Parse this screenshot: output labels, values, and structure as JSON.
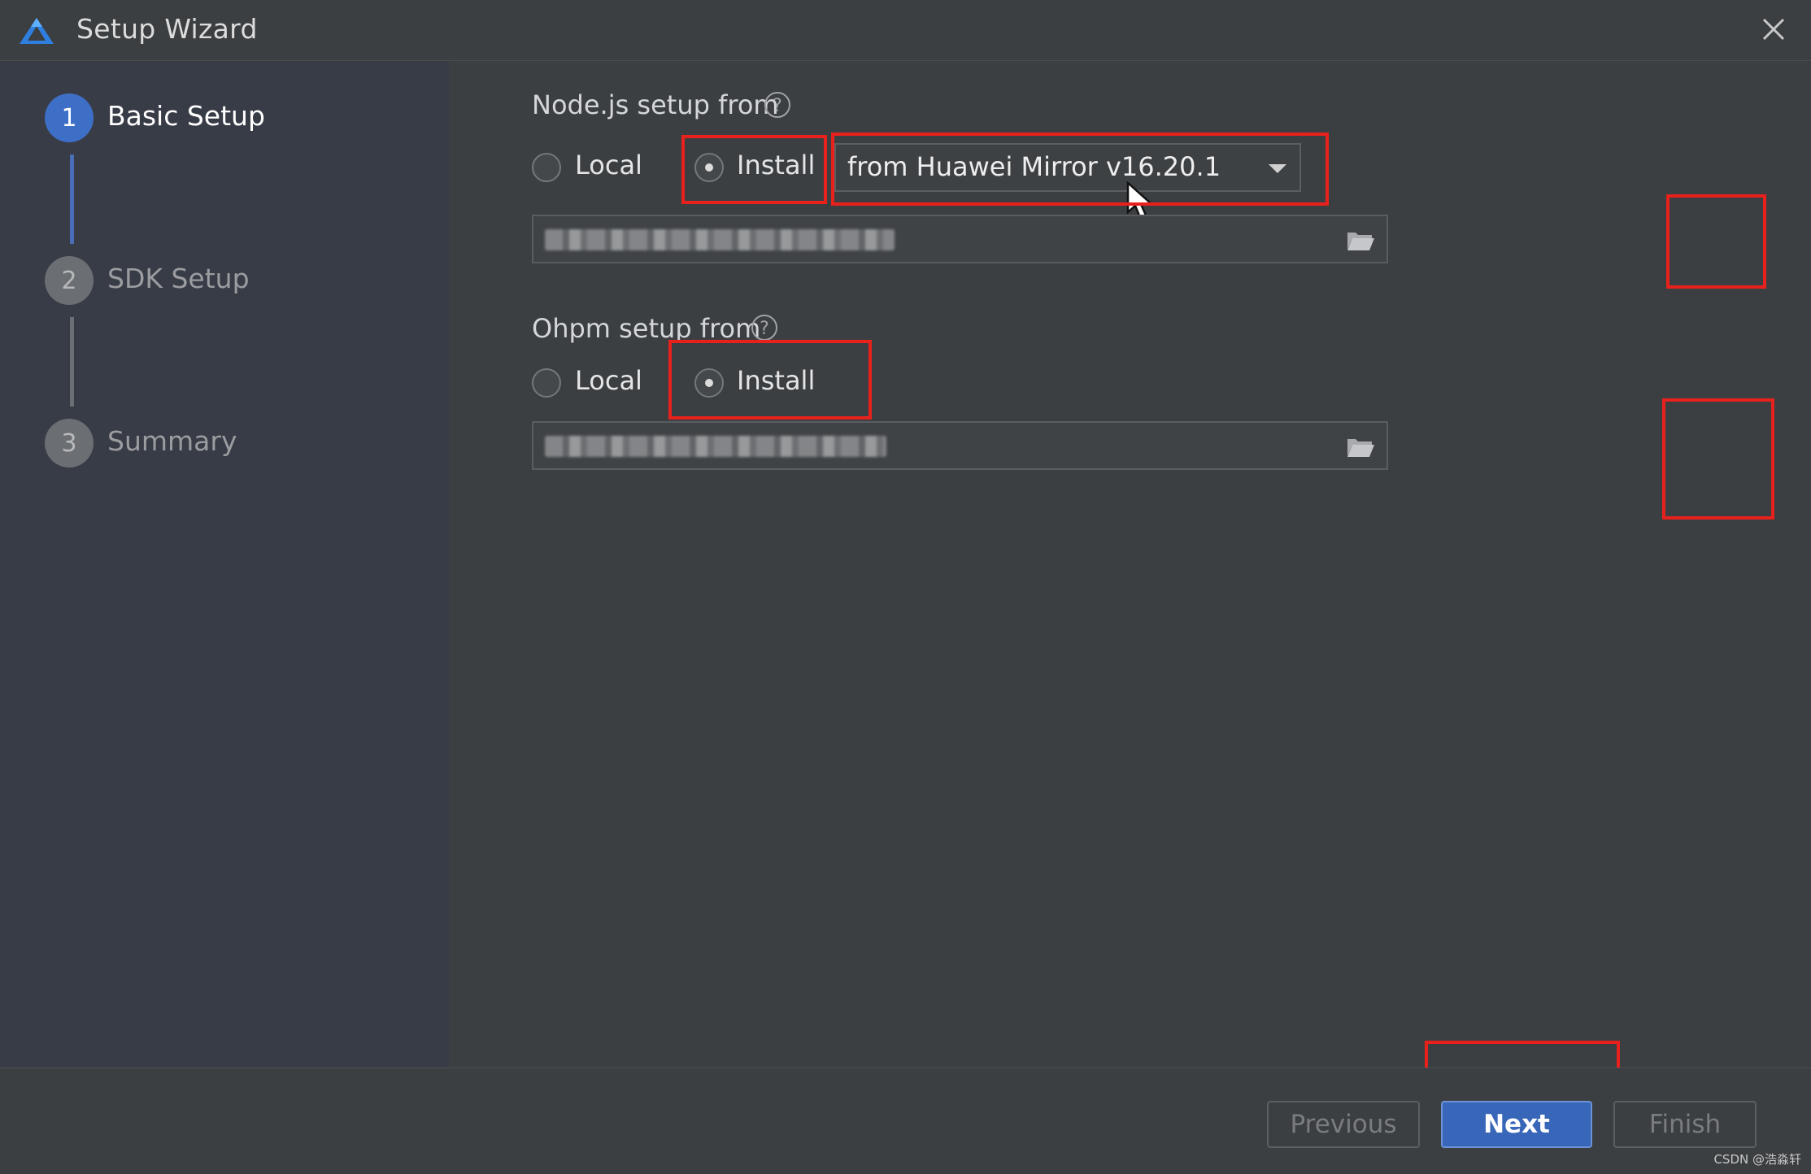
{
  "window": {
    "title": "Setup Wizard",
    "close_icon": "close-icon",
    "app_icon": "deveco-logo-icon"
  },
  "sidebar": {
    "steps": [
      {
        "number": "1",
        "label": "Basic Setup",
        "state": "active"
      },
      {
        "number": "2",
        "label": "SDK Setup",
        "state": "inactive"
      },
      {
        "number": "3",
        "label": "Summary",
        "state": "inactive"
      }
    ]
  },
  "nodejs": {
    "label": "Node.js setup from",
    "options": [
      "Local",
      "Install"
    ],
    "selected": "Install",
    "source_value": "from Huawei Mirror v16.20.1",
    "path_value": ""
  },
  "ohpm": {
    "label": "Ohpm setup from",
    "options": [
      "Local",
      "Install"
    ],
    "selected": "Install",
    "path_value": ""
  },
  "footer": {
    "previous_label": "Previous",
    "next_label": "Next",
    "finish_label": "Finish"
  },
  "watermark": "CSDN @浩淼轩",
  "colors": {
    "accent": "#3866b8",
    "step_active": "#3e6fc7",
    "highlight": "#e8211c",
    "background": "#3c3f41"
  }
}
